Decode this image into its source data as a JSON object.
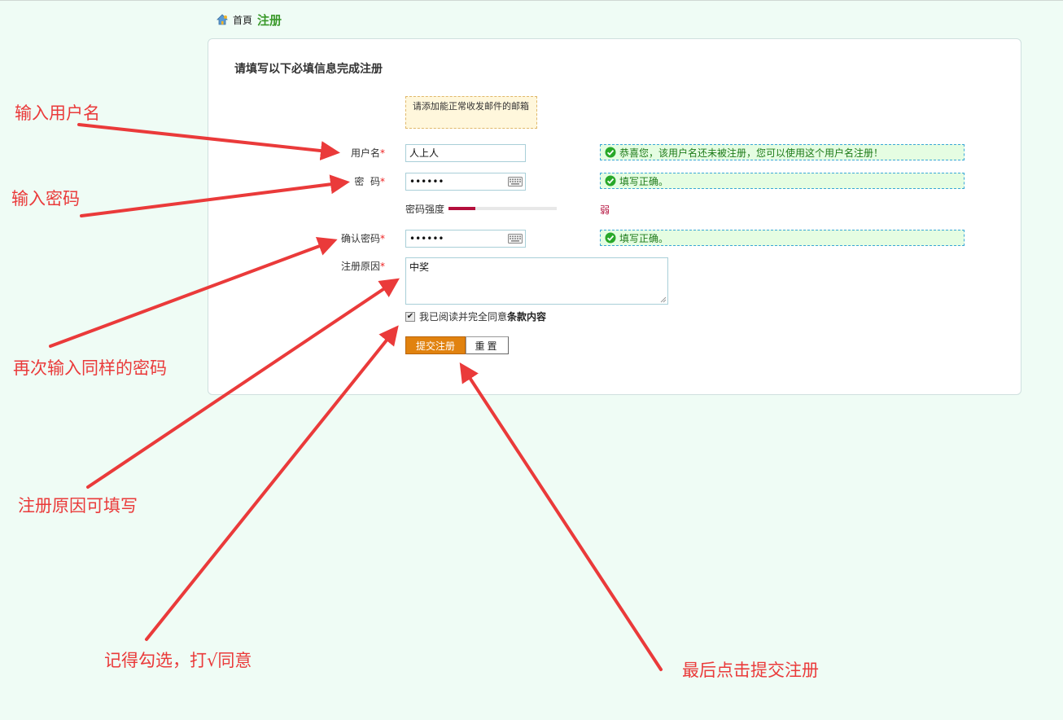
{
  "breadcrumb": {
    "home": "首頁",
    "current": "注册"
  },
  "form": {
    "heading": "请填写以下必填信息完成注册",
    "notice": "请添加能正常收发邮件的邮箱",
    "username": {
      "label": "用户名",
      "required_mark": "*",
      "value": "人上人",
      "message": "恭喜您，该用户名还未被注册，您可以使用这个用户名注册！"
    },
    "password": {
      "label": "密  码",
      "required_mark": "*",
      "value": "••••••",
      "message": "填写正确。"
    },
    "strength": {
      "label": "密码强度",
      "value_text": "弱",
      "level": 0.25
    },
    "confirm": {
      "label": "确认密码",
      "required_mark": "*",
      "value": "••••••",
      "message": "填写正确。"
    },
    "reason": {
      "label": "注册原因",
      "required_mark": "*",
      "value": "中奖"
    },
    "agreement": {
      "checked": true,
      "text": "我已阅读并完全同意",
      "terms_link": "条款内容"
    },
    "submit_label": "提交注册",
    "reset_label": "重置"
  },
  "annotations": {
    "username": "输入用户名",
    "password": "输入密码",
    "confirm": "再次输入同样的密码",
    "reason": "注册原因可填写",
    "agree": "记得勾选，打√同意",
    "submit": "最后点击提交注册"
  },
  "colors": {
    "background": "#effcf5",
    "annotation": "#ea3a3a",
    "success_text": "#1d7a18",
    "submit_button": "#e1820f",
    "strength_weak": "#b40f3c"
  }
}
